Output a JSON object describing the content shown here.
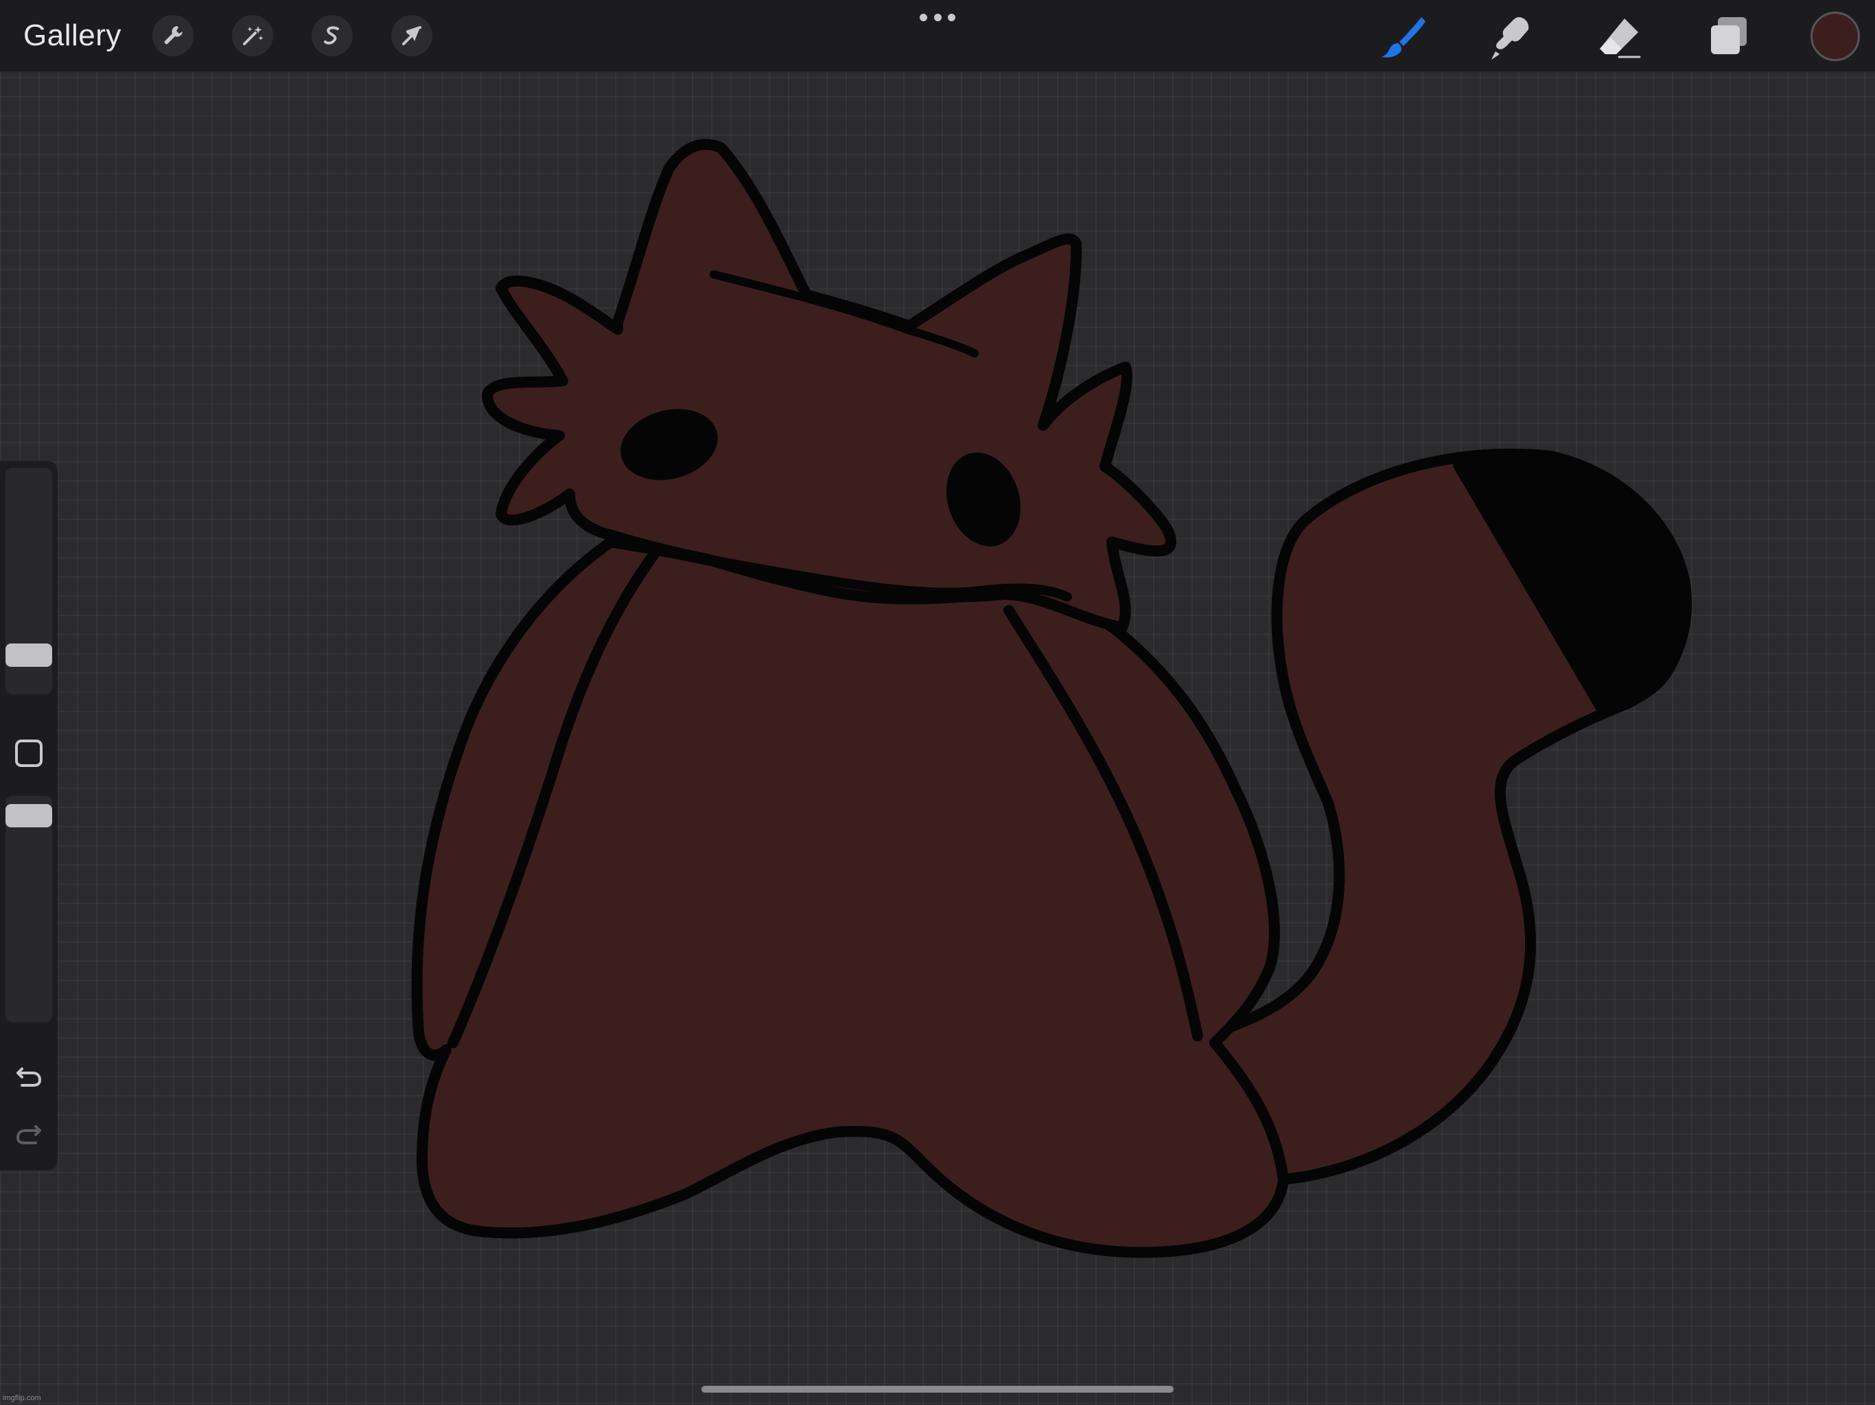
{
  "toolbar": {
    "gallery_label": "Gallery",
    "left_tools": [
      {
        "name": "actions",
        "icon": "wrench-icon"
      },
      {
        "name": "adjustments",
        "icon": "magic-wand-icon"
      },
      {
        "name": "selection",
        "icon": "selection-s-icon"
      },
      {
        "name": "transform",
        "icon": "arrow-cursor-icon"
      }
    ],
    "right_tools": [
      {
        "name": "brush",
        "icon": "brush-icon",
        "active": true
      },
      {
        "name": "smudge",
        "icon": "smudge-finger-icon",
        "active": false
      },
      {
        "name": "eraser",
        "icon": "eraser-icon",
        "active": false
      },
      {
        "name": "layers",
        "icon": "layers-icon",
        "active": false
      }
    ],
    "current_color": "#3c1f1d"
  },
  "sidebar": {
    "brush_size_level": 0.9,
    "opacity_level": 0.93,
    "undo_icon": "undo-arrow-icon",
    "redo_icon": "redo-arrow-icon"
  },
  "colors": {
    "accent": "#1f75e6",
    "fill": "#3c1f1d",
    "outline": "#050505"
  },
  "watermark": "imgflip.com"
}
